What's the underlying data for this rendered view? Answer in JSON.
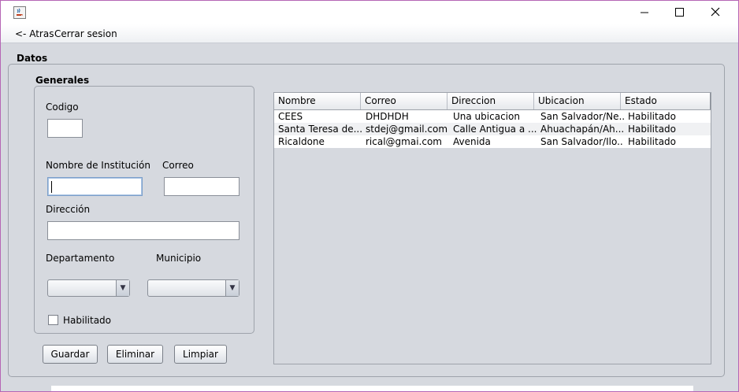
{
  "window": {
    "controls": {
      "minimize": "—",
      "maximize": "☐",
      "close": "✕"
    }
  },
  "menu": {
    "back": "<- Atras",
    "logout": "Cerrar sesion"
  },
  "datos": {
    "title": "Datos"
  },
  "generales": {
    "title": "Generales",
    "codigo_label": "Codigo",
    "codigo_value": "",
    "nombre_label": "Nombre de Institución",
    "nombre_value": "",
    "correo_label": "Correo",
    "correo_value": "",
    "direccion_label": "Dirección",
    "direccion_value": "",
    "departamento_label": "Departamento",
    "departamento_value": "",
    "municipio_label": "Municipio",
    "municipio_value": "",
    "habilitado_label": "Habilitado",
    "habilitado_checked": false
  },
  "buttons": {
    "guardar": "Guardar",
    "eliminar": "Eliminar",
    "limpiar": "Limpiar"
  },
  "table": {
    "columns": [
      "Nombre",
      "Correo",
      "Direccion",
      "Ubicacion",
      "Estado"
    ],
    "rows": [
      [
        "CEES",
        "DHDHDH",
        "Una ubicacion",
        "San Salvador/Ne...",
        "Habilitado"
      ],
      [
        "Santa Teresa de...",
        "stdej@gmail.com",
        "Calle Antigua a ...",
        "Ahuachapán/Ah...",
        "Habilitado"
      ],
      [
        "Ricaldone",
        "rical@gmai.com",
        "Avenida",
        "San Salvador/Ilo...",
        "Habilitado"
      ]
    ]
  },
  "colors": {
    "window_border": "#b566b5",
    "panel_bg": "#d6d9df",
    "focus_border": "#7b9fca"
  },
  "icons": {
    "app": "java-coffee-icon",
    "combo_arrow": "chevron-down-icon"
  }
}
